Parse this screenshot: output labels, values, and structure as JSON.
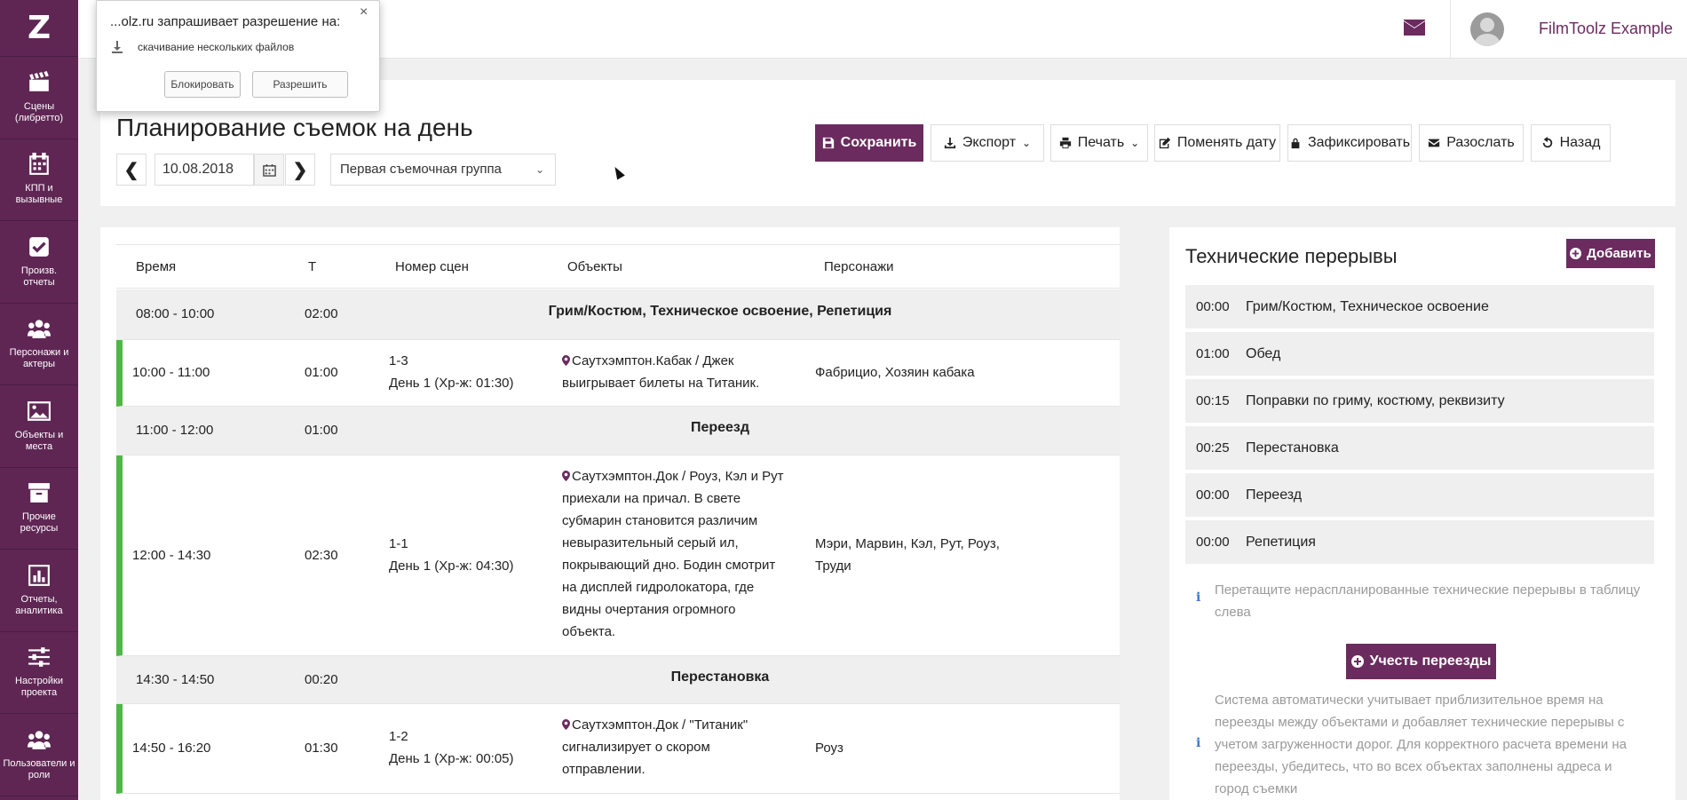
{
  "sidebar": {
    "logo": "Z",
    "items": [
      {
        "label": "Сцены\n(либретто)",
        "icon": "clapperboard-icon"
      },
      {
        "label": "КПП и\nвызывные",
        "icon": "calendar-icon"
      },
      {
        "label": "Произв.\nотчеты",
        "icon": "checkbox-icon"
      },
      {
        "label": "Персонажи и\nактеры",
        "icon": "users-icon"
      },
      {
        "label": "Объекты и\nместа",
        "icon": "image-icon"
      },
      {
        "label": "Прочие\nресурсы",
        "icon": "archive-icon"
      },
      {
        "label": "Отчеты,\nаналитика",
        "icon": "bar-chart-icon"
      },
      {
        "label": "Настройки\nпроекта",
        "icon": "sliders-icon"
      },
      {
        "label": "Пользователи и\nроли",
        "icon": "users-icon"
      }
    ]
  },
  "topbar": {
    "user_name": "FilmToolz Example"
  },
  "header": {
    "title": "Планирование съемок на день",
    "date": "10.08.2018",
    "prev": "❮",
    "next": "❯",
    "group": "Первая съемочная группа",
    "buttons": {
      "save": "Сохранить",
      "export": "Экспорт",
      "print": "Печать",
      "change_date": "Поменять дату",
      "lock": "Зафиксировать",
      "send": "Разослать",
      "back": "Назад"
    }
  },
  "schedule": {
    "columns": [
      "Время",
      "Т",
      "Номер сцен",
      "Объекты",
      "Персонажи"
    ],
    "rows": [
      {
        "type": "break",
        "time": "08:00 - 10:00",
        "duration": "02:00",
        "name": "Грим/Костюм, Техническое освоение, Репетиция"
      },
      {
        "type": "scene",
        "time": "10:00 - 11:00",
        "duration": "01:00",
        "scene_no": "1-3",
        "scene_day": "День 1 (Хр-ж: 01:30)",
        "location": "Саутхэмптон.Кабак",
        "desc": " / Джек выигрывает билеты на Титаник.",
        "characters": "Фабрицио, Хозяин кабака"
      },
      {
        "type": "break",
        "time": "11:00 - 12:00",
        "duration": "01:00",
        "name": "Переезд"
      },
      {
        "type": "scene",
        "time": "12:00 - 14:30",
        "duration": "02:30",
        "scene_no": "1-1",
        "scene_day": "День 1 (Хр-ж: 04:30)",
        "location": "Саутхэмптон.Док",
        "desc": " / Роуз, Кэл и Рут приехали на причал. В свете субмарин становится различим невыразительный серый ил, покрывающий дно. Бодин смотрит на дисплей гидролокатора, где видны очертания огромного объекта.",
        "characters": "Мэри, Марвин, Кэл, Рут, Роуз, Труди"
      },
      {
        "type": "break",
        "time": "14:30 - 14:50",
        "duration": "00:20",
        "name": "Перестановка"
      },
      {
        "type": "scene",
        "time": "14:50 - 16:20",
        "duration": "01:30",
        "scene_no": "1-2",
        "scene_day": "День 1 (Хр-ж: 00:05)",
        "location": "Саутхэмптон.Док",
        "desc": " / \"Титаник\" сигнализирует о скором отправлении.",
        "characters": "Роуз"
      }
    ]
  },
  "breaks_panel": {
    "title": "Технические перерывы",
    "add_label": "Добавить",
    "items": [
      {
        "time": "00:00",
        "name": "Грим/Костюм, Техническое освоение"
      },
      {
        "time": "01:00",
        "name": "Обед"
      },
      {
        "time": "00:15",
        "name": "Поправки по гриму, костюму, реквизиту"
      },
      {
        "time": "00:25",
        "name": "Перестановка"
      },
      {
        "time": "00:00",
        "name": "Переезд"
      },
      {
        "time": "00:00",
        "name": "Репетиция"
      }
    ],
    "hint_drag": "Перетащите нераспланированные технические перерывы в таблицу слева",
    "moves_label": "Учесть переезды",
    "hint_moves": "Система автоматически учитывает приблизительное время на переезды между объектами и добавляет технические перерывы с учетом загруженности дорог. Для корректного расчета времени на переезды, убедитесь, что во всех объектах заполнены адреса и город съемки"
  },
  "popup": {
    "title": "...olz.ru запрашивает разрешение на:",
    "close": "×",
    "text": "скачивание нескольких файлов",
    "block": "Блокировать",
    "allow": "Разрешить"
  },
  "colors": {
    "sidebar": "#5f2654",
    "primary": "#6b2b5f",
    "scene_marker": "#4cb944",
    "break_row": "#efefef"
  }
}
